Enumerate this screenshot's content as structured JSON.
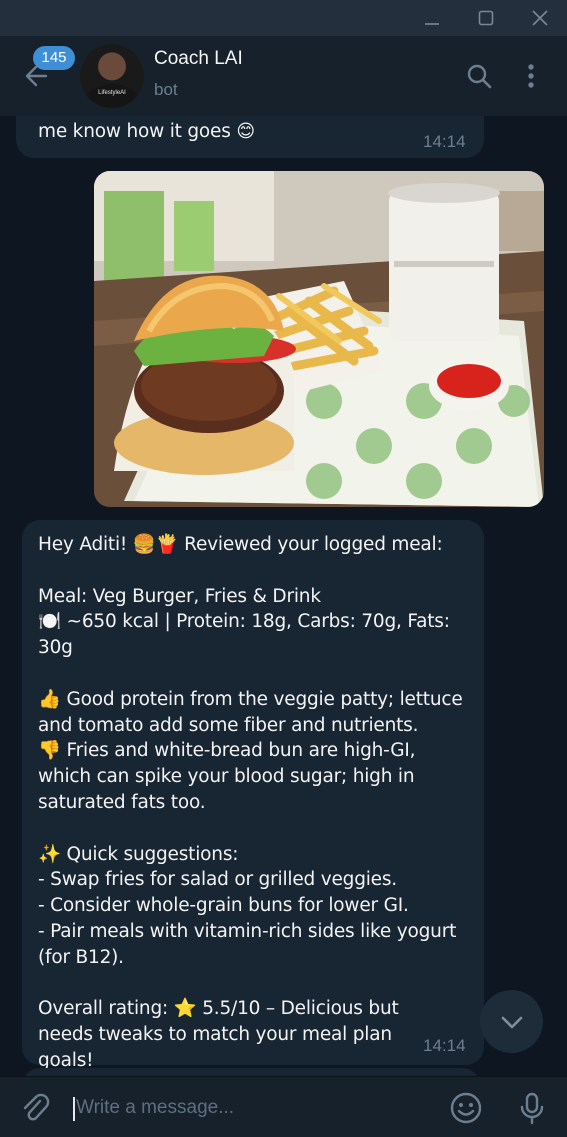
{
  "window": {
    "minimize_icon": "minimize-icon",
    "maximize_icon": "maximize-icon",
    "close_icon": "close-icon"
  },
  "header": {
    "unread_badge": "145",
    "chat_name": "Coach LAI",
    "chat_status": "bot",
    "avatar_logo": "LifestyleAI",
    "search_icon": "search-icon",
    "more_icon": "more-vertical-icon"
  },
  "messages": {
    "previous": {
      "text": "me know how it goes",
      "emoji": "😊",
      "time": "14:14"
    },
    "photo": {
      "description_icon": "meal-photo"
    },
    "reply": {
      "greeting": "Hey Aditi! 🍔🍟 Reviewed your logged meal:",
      "meal_line": "Meal: Veg Burger, Fries & Drink",
      "nutrition_line": "🍽️ ~650 kcal | Protein: 18g, Carbs: 70g, Fats: 30g",
      "good_line": "👍 Good protein from the veggie patty; lettuce and tomato add some fiber and nutrients.",
      "bad_line": "👎 Fries and white-bread bun are high-GI, which can spike your blood sugar; high in saturated fats too.",
      "suggestions_title": "✨ Quick suggestions:",
      "suggestion_1": "- Swap fries for salad or grilled veggies.",
      "suggestion_2": "- Consider whole-grain buns for lower GI.",
      "suggestion_3": "- Pair meals with vitamin-rich sides like yogurt (for B12).",
      "rating_line": "Overall rating: ⭐ 5.5/10 – Delicious but needs tweaks to match your meal plan goals!",
      "time": "14:14"
    }
  },
  "composer": {
    "placeholder": "Write a message...",
    "attach_icon": "paperclip-icon",
    "emoji_icon": "emoji-icon",
    "mic_icon": "microphone-icon"
  },
  "colors": {
    "background": "#0e1621",
    "header": "#17212b",
    "bubble": "#182533",
    "accent": "#3e8fd6",
    "muted_text": "#6d7f8f"
  }
}
